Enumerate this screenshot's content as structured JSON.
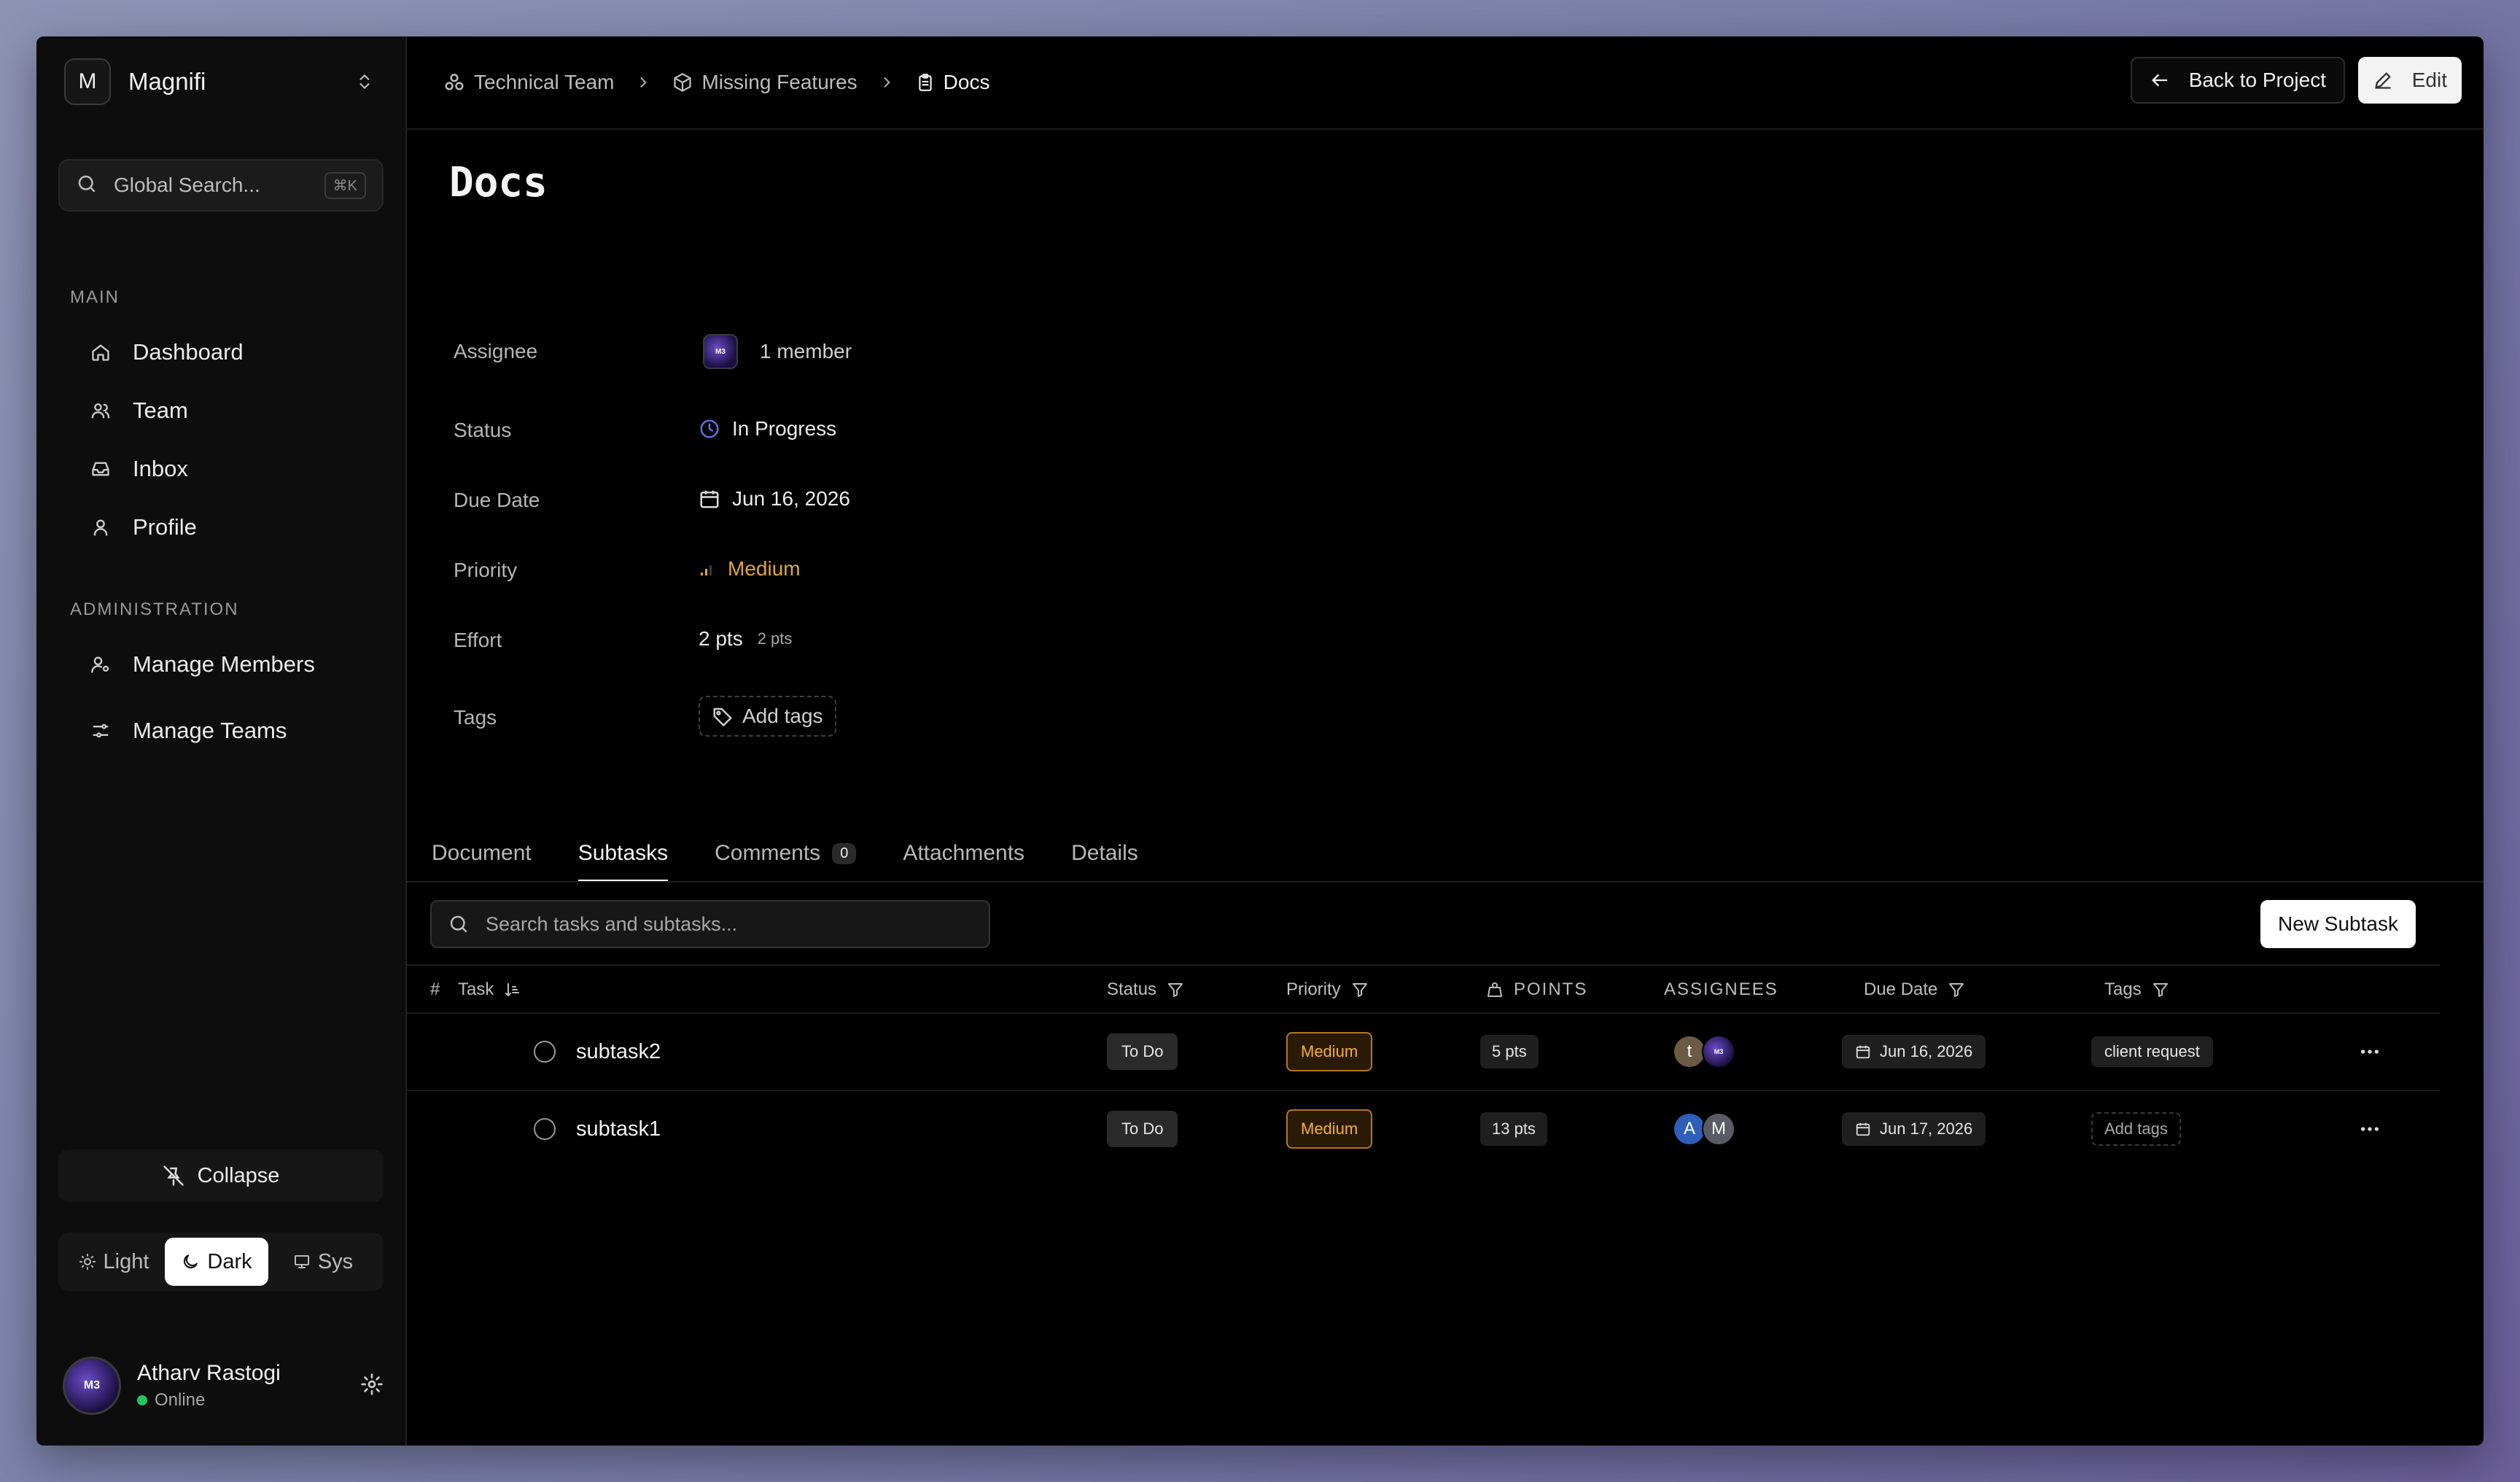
{
  "sidebar": {
    "workspace_initial": "M",
    "workspace_name": "Magnifi",
    "search_placeholder": "Global Search...",
    "search_shortcut": "⌘K",
    "main_label": "MAIN",
    "main_items": [
      {
        "label": "Dashboard",
        "icon": "home-icon"
      },
      {
        "label": "Team",
        "icon": "users-icon"
      },
      {
        "label": "Inbox",
        "icon": "inbox-icon"
      },
      {
        "label": "Profile",
        "icon": "user-icon"
      }
    ],
    "admin_label": "ADMINISTRATION",
    "admin_items": [
      {
        "label": "Manage Members",
        "icon": "user-cog-icon"
      },
      {
        "label": "Manage Teams",
        "icon": "sliders-icon"
      }
    ],
    "collapse_label": "Collapse",
    "theme": {
      "light": "Light",
      "dark": "Dark",
      "sys": "Sys",
      "selected": "Dark"
    },
    "user": {
      "name": "Atharv Rastogi",
      "status": "Online",
      "avatar_text": "M3"
    }
  },
  "breadcrumb": [
    {
      "label": "Technical Team",
      "icon": "team-icon"
    },
    {
      "label": "Missing Features",
      "icon": "box-icon"
    },
    {
      "label": "Docs",
      "icon": "clipboard-icon"
    }
  ],
  "header": {
    "back_label": "Back to Project",
    "edit_label": "Edit"
  },
  "page_title": "Docs",
  "properties": {
    "assignee_label": "Assignee",
    "assignee_value": "1 member",
    "status_label": "Status",
    "status_value": "In Progress",
    "due_label": "Due Date",
    "due_value": "Jun 16, 2026",
    "priority_label": "Priority",
    "priority_value": "Medium",
    "effort_label": "Effort",
    "effort_value": "2 pts",
    "effort_sub": "2 pts",
    "tags_label": "Tags",
    "tags_add": "Add tags"
  },
  "tabs": [
    {
      "label": "Document"
    },
    {
      "label": "Subtasks",
      "active": true
    },
    {
      "label": "Comments",
      "count": "0"
    },
    {
      "label": "Attachments"
    },
    {
      "label": "Details"
    }
  ],
  "subtasks": {
    "search_placeholder": "Search tasks and subtasks...",
    "new_label": "New Subtask",
    "columns": {
      "hash": "#",
      "task": "Task",
      "status": "Status",
      "priority": "Priority",
      "points": "POINTS",
      "assignees": "ASSIGNEES",
      "due": "Due Date",
      "tags": "Tags"
    },
    "rows": [
      {
        "name": "subtask2",
        "status": "To Do",
        "priority": "Medium",
        "points": "5 pts",
        "assignees": [
          "t",
          "M3"
        ],
        "due": "Jun 16, 2026",
        "tag": "client request"
      },
      {
        "name": "subtask1",
        "status": "To Do",
        "priority": "Medium",
        "points": "13 pts",
        "assignees": [
          "A",
          "M"
        ],
        "due": "Jun 17, 2026",
        "tag": "Add tags"
      }
    ]
  },
  "colors": {
    "accent_priority": "#e0a82e",
    "status_progress": "#4f6bd8",
    "online": "#22c55e"
  }
}
